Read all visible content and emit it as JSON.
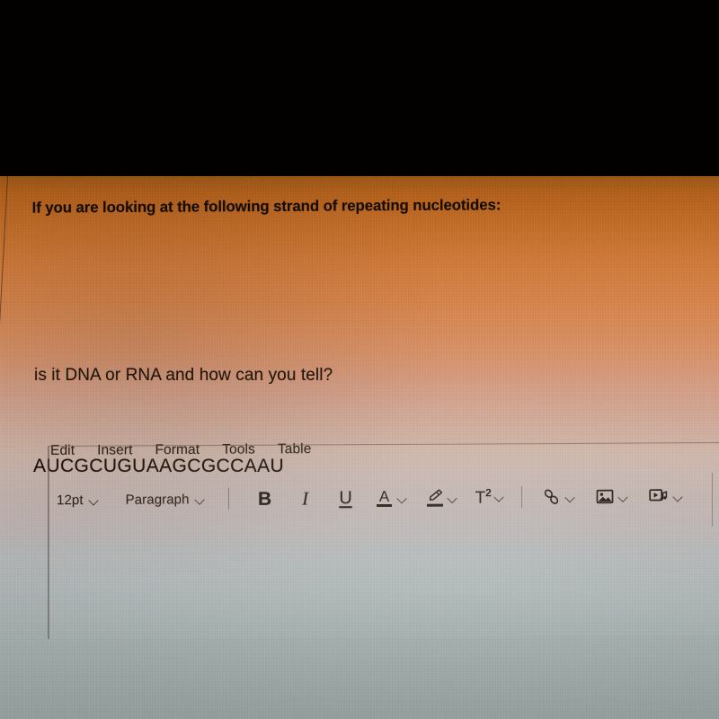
{
  "document": {
    "prompt": "If you are looking at the following strand of repeating nucleotides:",
    "sequence": "AUCGCUGUAAGCGCCAAU",
    "question": "is it DNA or RNA and how can you tell?"
  },
  "editor": {
    "menubar": {
      "items": [
        {
          "label": "Edit"
        },
        {
          "label": "Insert"
        },
        {
          "label": "Format"
        },
        {
          "label": "Tools"
        },
        {
          "label": "Table"
        }
      ]
    },
    "toolbar": {
      "font_size": {
        "value": "12pt",
        "icon": "chevron-down-icon"
      },
      "block_format": {
        "value": "Paragraph",
        "icon": "chevron-down-icon"
      },
      "bold": {
        "label": "B",
        "icon": "bold-icon"
      },
      "italic": {
        "label": "I",
        "icon": "italic-icon"
      },
      "underline": {
        "label": "U",
        "icon": "underline-icon"
      },
      "text_color": {
        "label": "A",
        "icon": "text-color-icon"
      },
      "highlight": {
        "icon": "highlighter-icon"
      },
      "superscript": {
        "label": "T",
        "sup": "2",
        "icon": "superscript-icon"
      },
      "link": {
        "icon": "link-icon"
      },
      "image": {
        "icon": "image-icon"
      },
      "media": {
        "icon": "media-icon"
      }
    },
    "content": {
      "value": "",
      "placeholder": ""
    }
  },
  "colors": {
    "screen_top": "#9a5718",
    "screen_mid": "#d07c3d",
    "screen_toolbar": "#cdb4a8",
    "screen_bottom": "#a3adaa",
    "text": "#150c04",
    "letterbox": "#020100"
  }
}
